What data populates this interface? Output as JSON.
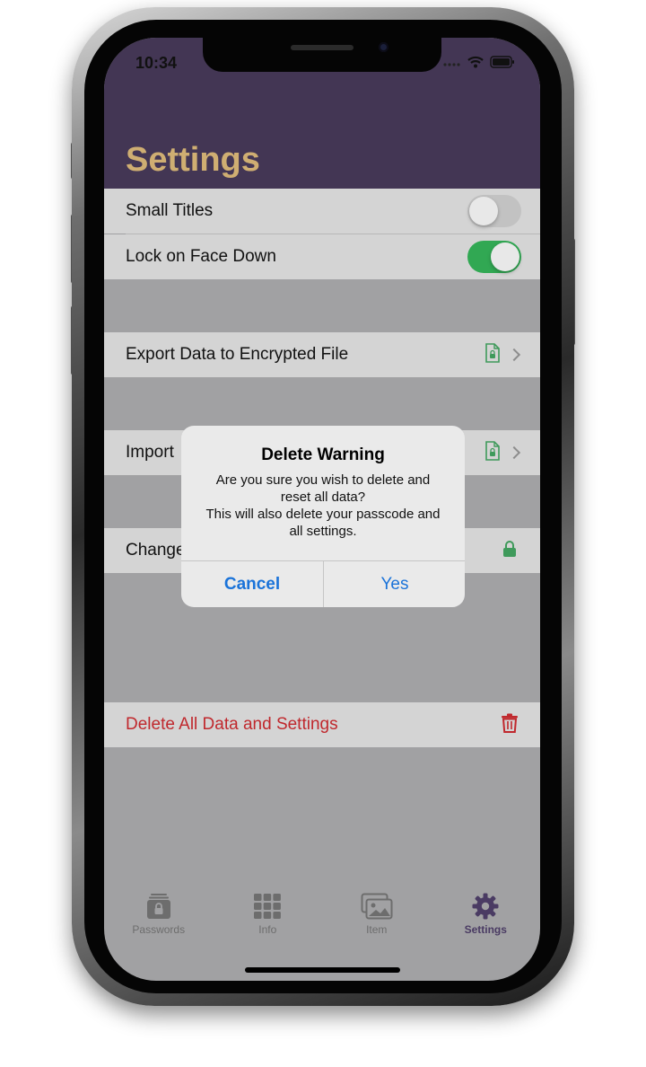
{
  "status_bar": {
    "time": "10:34"
  },
  "page": {
    "title": "Settings"
  },
  "settings": {
    "small_titles": {
      "label": "Small Titles",
      "enabled": false
    },
    "lock_face_down": {
      "label": "Lock on Face Down",
      "enabled": true
    },
    "export": {
      "label": "Export Data to Encrypted File"
    },
    "import": {
      "label": "Import"
    },
    "change": {
      "label": "Change"
    },
    "delete_all": {
      "label": "Delete All Data and Settings"
    }
  },
  "alert": {
    "title": "Delete Warning",
    "message": "Are you sure you wish to delete and\nreset all data?\nThis will also delete your passcode and\nall settings.",
    "cancel_label": "Cancel",
    "yes_label": "Yes"
  },
  "tabs": [
    {
      "label": "Passwords",
      "icon": "passwords-icon"
    },
    {
      "label": "Info",
      "icon": "grid-icon"
    },
    {
      "label": "Item",
      "icon": "photos-icon"
    },
    {
      "label": "Settings",
      "icon": "gear-icon",
      "active": true
    }
  ],
  "colors": {
    "header": "#433654",
    "title": "#cfae72",
    "toggle_on": "#31a853",
    "file_icon": "#3f9a5b",
    "danger": "#c0282d",
    "alert_button": "#1a73d9"
  }
}
